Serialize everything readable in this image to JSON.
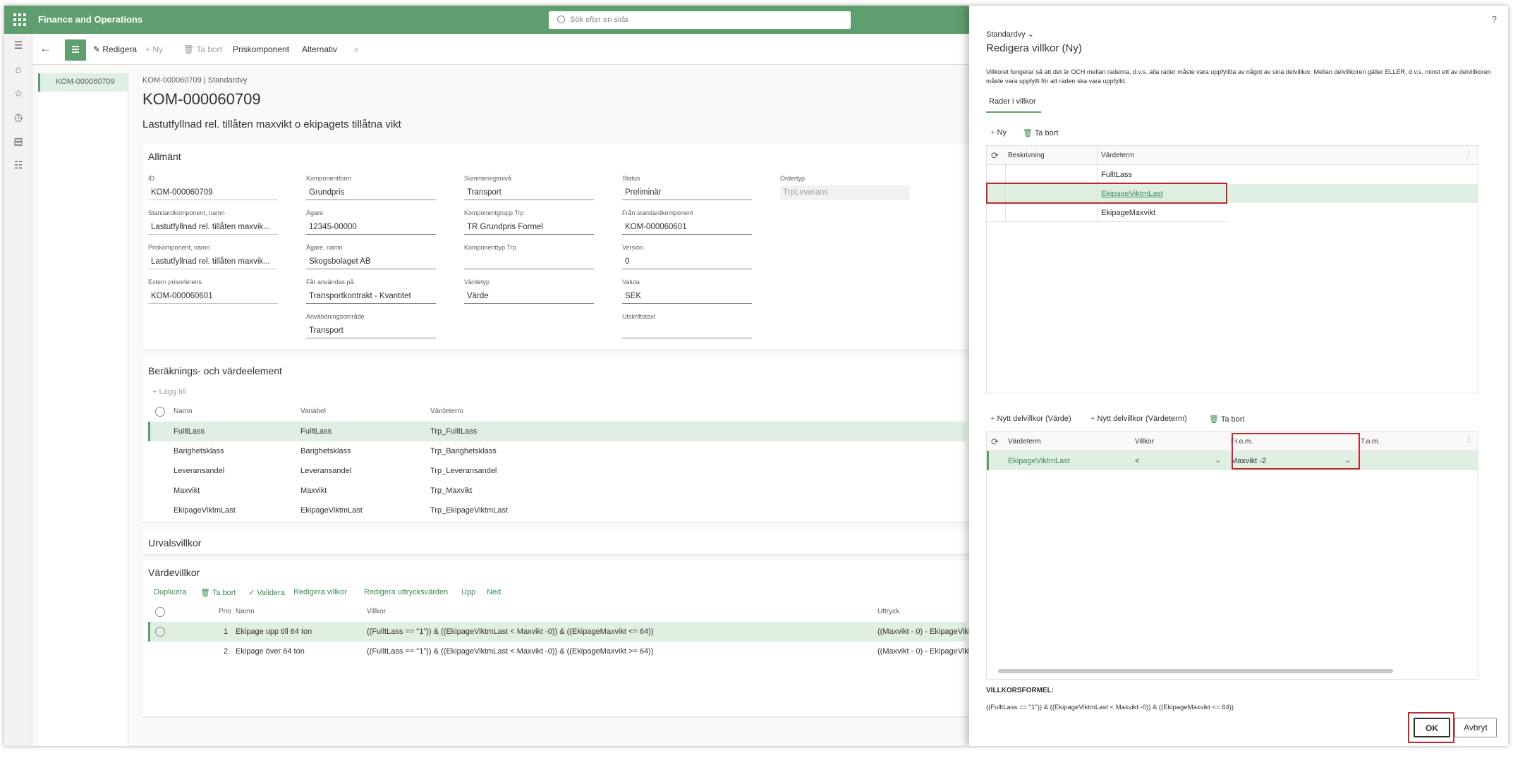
{
  "app": {
    "name": "Finance and Operations",
    "search_placeholder": "Sök efter en sida"
  },
  "actionpane": {
    "edit": "Redigera",
    "new": "Ny",
    "delete": "Ta bort",
    "price_component": "Priskomponent",
    "options": "Alternativ"
  },
  "list": {
    "selected": "KOM-000060709"
  },
  "record": {
    "crumb": "KOM-000060709  |  Standardvy",
    "title": "KOM-000060709",
    "subtitle": "Lastutfyllnad rel. tillåten maxvikt o ekipagets tillåtna vikt"
  },
  "general": {
    "header": "Allmänt",
    "fields": {
      "id": {
        "label": "ID",
        "value": "KOM-000060709"
      },
      "std_name": {
        "label": "Standardkomponent, namn",
        "value": "Lastutfyllnad rel. tillåten maxvik..."
      },
      "price_name": {
        "label": "Priskomponent, namn",
        "value": "Lastutfyllnad rel. tillåten maxvik..."
      },
      "ext_ref": {
        "label": "Extern prisreferens",
        "value": "KOM-000060601"
      },
      "comp_form": {
        "label": "Komponentform",
        "value": "Grundpris"
      },
      "owner": {
        "label": "Ägare",
        "value": "12345-00000"
      },
      "owner_name": {
        "label": "Ägare, namn",
        "value": "Skogsbolaget AB"
      },
      "usable_on": {
        "label": "Får användas på",
        "value": "Transportkontrakt - Kvantitet"
      },
      "use_area": {
        "label": "Användningsområde",
        "value": "Transport"
      },
      "sum_level": {
        "label": "Summeringsnivå",
        "value": "Transport"
      },
      "comp_group": {
        "label": "Komponentgrupp Trp",
        "value": "TR Grundpris Formel"
      },
      "comp_type": {
        "label": "Komponenttyp Trp",
        "value": ""
      },
      "value_type": {
        "label": "Värdetyp",
        "value": "Värde"
      },
      "status": {
        "label": "Status",
        "value": "Preliminär"
      },
      "from_std": {
        "label": "Från standardkomponent",
        "value": "KOM-000060601"
      },
      "version": {
        "label": "Version",
        "value": "0"
      },
      "currency": {
        "label": "Valuta",
        "value": "SEK"
      },
      "print_text": {
        "label": "Utskriftstext",
        "value": ""
      },
      "order_type": {
        "label": "Ordertyp",
        "value": "TrpLeverans"
      }
    }
  },
  "calc": {
    "header": "Beräknings- och värdeelement",
    "add": "Lägg till",
    "columns": [
      "Namn",
      "Variabel",
      "Värdeterm"
    ],
    "rows": [
      [
        "FulltLass",
        "FulltLass",
        "Trp_FulltLass"
      ],
      [
        "Barighetsklass",
        "Barighetsklass",
        "Trp_Barighetsklass"
      ],
      [
        "Leveransandel",
        "Leveransandel",
        "Trp_Leveransandel"
      ],
      [
        "Maxvikt",
        "Maxvikt",
        "Trp_Maxvikt"
      ],
      [
        "EkipageViktmLast",
        "EkipageViktmLast",
        "Trp_EkipageViktmLast"
      ]
    ]
  },
  "selection": {
    "header": "Urvalsvillkor"
  },
  "valuecond": {
    "header": "Värdevillkor",
    "commands": [
      "Duplicera",
      "Ta bort",
      "Validera",
      "Redigera villkor",
      "Redigera uttrycksvärden",
      "Upp",
      "Ned"
    ],
    "columns": [
      "Prio",
      "Namn",
      "Villkor",
      "Uttryck"
    ],
    "rows": [
      [
        "1",
        "Ekipage upp till 64 ton",
        "((FulltLass == \"1\")) & ((EkipageViktmLast < Maxvikt -0)) & ((EkipageMaxvikt <= 64))",
        "((Maxvikt - 0) - EkipageVikt"
      ],
      [
        "2",
        "Ekipage över 64 ton",
        "((FulltLass == \"1\")) & ((EkipageViktmLast < Maxvikt -0)) & ((EkipageMaxvikt >= 64))",
        "((Maxvikt - 0) - EkipageVikt"
      ]
    ]
  },
  "dialog": {
    "help": "?",
    "view": "Standardvy",
    "title": "Redigera villkor (Ny)",
    "description": "Villkoret fungerar så att det är OCH mellan raderna, d.v.s. alla rader måste vara uppfyllda av något av sina delvillkor. Mellan delvillkoren gäller ELLER, d.v.s. minst ett av delvillkoren måste vara uppfyllt för att raden ska vara uppfylld.",
    "tab": "Rader i villkor",
    "new": "Ny",
    "delete": "Ta bort",
    "rows_grid": {
      "columns": [
        "Beskrivning",
        "Värdeterm"
      ],
      "rows": [
        "FulltLass",
        "EkipageViktmLast",
        "EkipageMaxvikt"
      ]
    },
    "sub_commands": [
      "Nytt delvillkor (Värde)",
      "Nytt delvillkor (Värdeterm)",
      "Ta bort"
    ],
    "sub_grid": {
      "columns": [
        "Värdeterm",
        "Villkor",
        "Fr.o.m.",
        "T.o.m."
      ],
      "row": {
        "term": "EkipageViktmLast",
        "cond": "<",
        "from": "Maxvikt -2",
        "to": ""
      }
    },
    "formula_label": "VILLKORSFORMEL:",
    "formula": "((FulltLass == \"1\")) & ((EkipageViktmLast < Maxvikt -0)) & ((EkipageMaxvikt <= 64))",
    "ok": "OK",
    "cancel": "Avbryt"
  },
  "colors": {
    "accent": "#5f9e6e",
    "selected_row": "#dff0e3",
    "highlight": "#c0292f",
    "link": "#3c8a56"
  }
}
